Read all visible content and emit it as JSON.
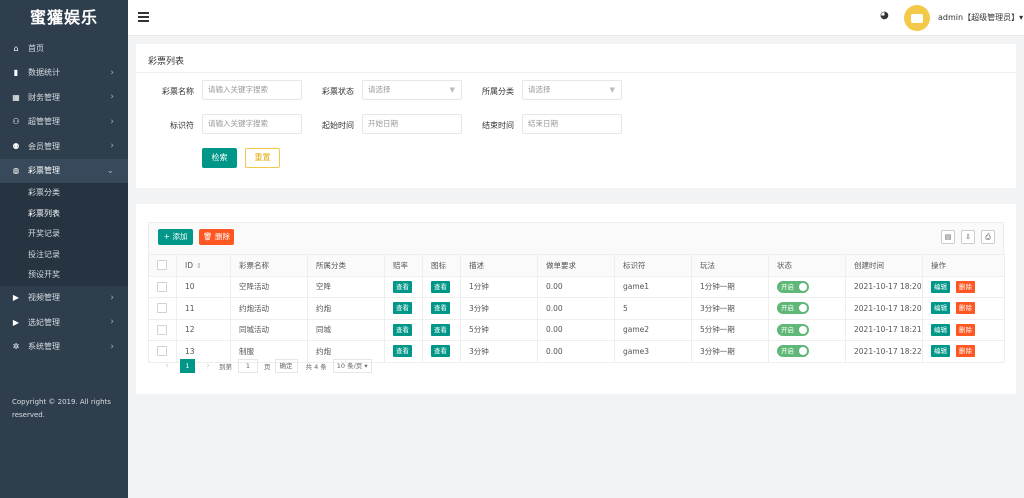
{
  "sidebar": {
    "logo": "蜜獾娱乐",
    "items": [
      {
        "label": "首页",
        "icon": "home-icon",
        "glyph": "⌂",
        "arrow": ""
      },
      {
        "label": "数据统计",
        "icon": "bar-chart-icon",
        "glyph": "▮",
        "arrow": "›"
      },
      {
        "label": "财务管理",
        "icon": "bank-icon",
        "glyph": "▦",
        "arrow": "›"
      },
      {
        "label": "超管管理",
        "icon": "user-plus-icon",
        "glyph": "⚇",
        "arrow": "›"
      },
      {
        "label": "会员管理",
        "icon": "users-icon",
        "glyph": "⚉",
        "arrow": "›"
      },
      {
        "label": "彩票管理",
        "icon": "gamepad-icon",
        "glyph": "◍",
        "arrow": "⌄"
      }
    ],
    "submenu": [
      "彩票分类",
      "彩票列表",
      "开奖记录",
      "投注记录",
      "预设开奖"
    ],
    "items_bottom": [
      {
        "label": "视频管理",
        "icon": "video-icon",
        "glyph": "▶",
        "arrow": "›"
      },
      {
        "label": "选妃管理",
        "icon": "camera-icon",
        "glyph": "▶",
        "arrow": "›"
      },
      {
        "label": "系统管理",
        "icon": "gear-icon",
        "glyph": "✲",
        "arrow": "›"
      }
    ],
    "copyright": "Copyright © 2019. All rights reserved."
  },
  "header": {
    "user": "admin【超级管理员】▾"
  },
  "search": {
    "title": "彩票列表",
    "name_label": "彩票名称",
    "name_placeholder": "请输入关键字搜索",
    "status_label": "彩票状态",
    "status_placeholder": "请选择",
    "category_label": "所属分类",
    "category_placeholder": "请选择",
    "tag_label": "标识符",
    "tag_placeholder": "请输入关键字搜索",
    "start_label": "起始时间",
    "start_placeholder": "开始日期",
    "end_label": "结束时间",
    "end_placeholder": "结束日期",
    "search_btn": "检索",
    "reset_btn": "重置"
  },
  "toolbar": {
    "add": "+ 添加",
    "delete": "🗑 删除"
  },
  "table": {
    "headers": [
      "ID",
      "彩票名称",
      "所属分类",
      "赔率",
      "图标",
      "描述",
      "做单要求",
      "标识符",
      "玩法",
      "状态",
      "创建时间",
      "操作"
    ],
    "view_label": "查看",
    "switch_label": "开启",
    "edit_label": "编辑",
    "delete_label": "删除",
    "rows": [
      {
        "id": "10",
        "name": "空降活动",
        "category": "空降",
        "desc": "1分钟",
        "req": "0.00",
        "tag": "game1",
        "play": "1分钟一期",
        "created": "2021-10-17 18:20"
      },
      {
        "id": "11",
        "name": "约炮活动",
        "category": "约炮",
        "desc": "3分钟",
        "req": "0.00",
        "tag": "5",
        "play": "3分钟一期",
        "created": "2021-10-17 18:20"
      },
      {
        "id": "12",
        "name": "同城活动",
        "category": "同城",
        "desc": "5分钟",
        "req": "0.00",
        "tag": "game2",
        "play": "5分钟一期",
        "created": "2021-10-17 18:21"
      },
      {
        "id": "13",
        "name": "制服",
        "category": "约炮",
        "desc": "3分钟",
        "req": "0.00",
        "tag": "game3",
        "play": "3分钟一期",
        "created": "2021-10-17 18:22"
      }
    ]
  },
  "pager": {
    "current": "1",
    "goto_label": "到第",
    "goto_value": "1",
    "page_unit": "页",
    "confirm": "确定",
    "total": "共 4 条",
    "size": "10 条/页 ▾"
  }
}
